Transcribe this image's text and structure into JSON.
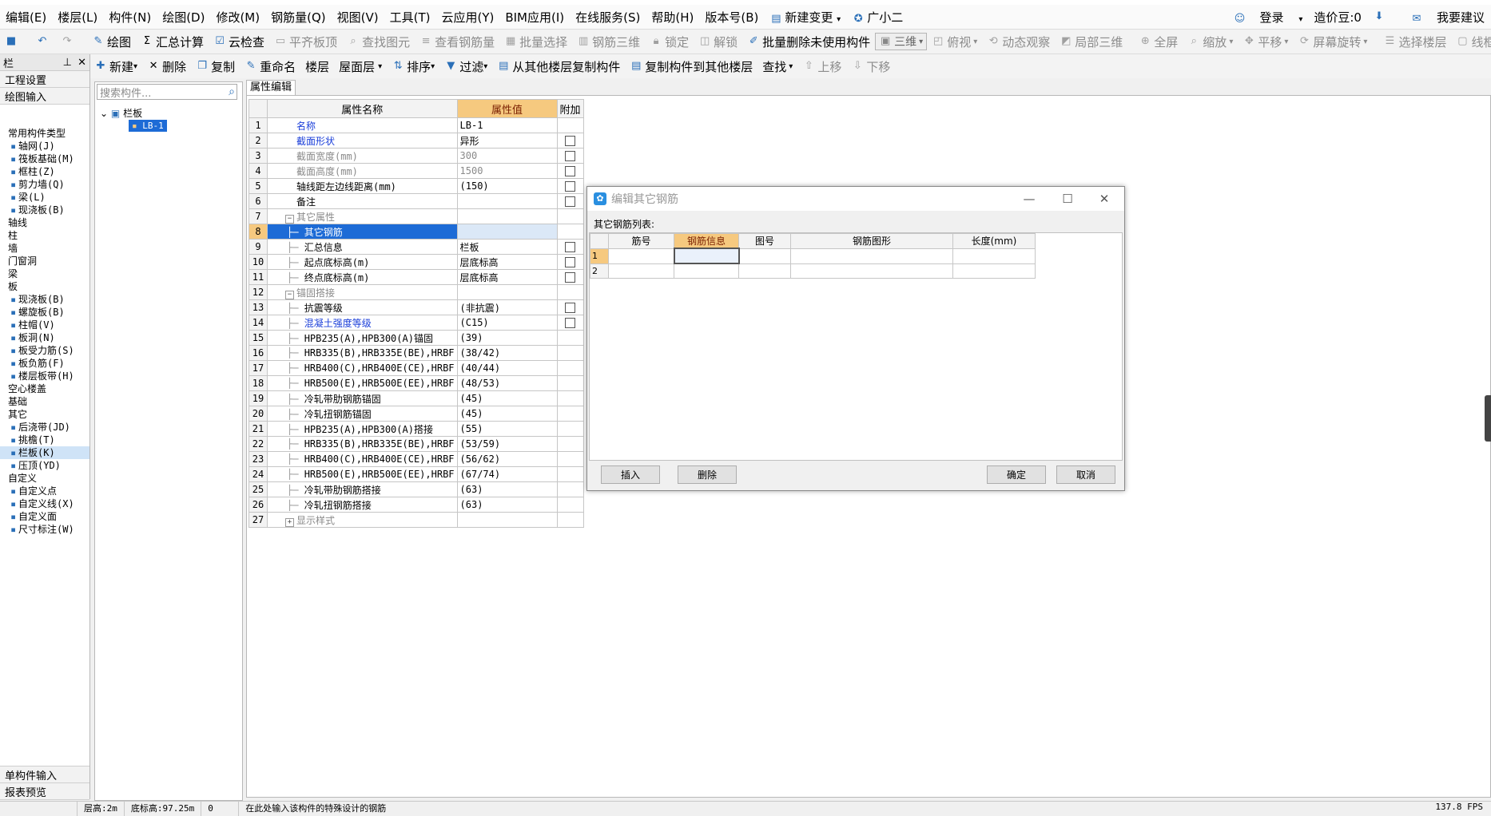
{
  "menu": {
    "items": [
      "编辑(E)",
      "楼层(L)",
      "构件(N)",
      "绘图(D)",
      "修改(M)",
      "钢筋量(Q)",
      "视图(V)",
      "工具(T)",
      "云应用(Y)",
      "BIM应用(I)",
      "在线服务(S)",
      "帮助(H)",
      "版本号(B)",
      "新建变更",
      "广小二"
    ],
    "login": "登录",
    "beans": "造价豆:0",
    "suggest": "我要建议"
  },
  "toolbar1": {
    "draw": "绘图",
    "sum": "汇总计算",
    "cloud_check": "云检查",
    "flat_top": "平齐板顶",
    "find_elem": "查找图元",
    "view_rebar": "查看钢筋量",
    "batch_select": "批量选择",
    "rebar_3d": "钢筋三维",
    "lock": "锁定",
    "unlock": "解锁",
    "batch_delete": "批量删除未使用构件",
    "view3d": "三维",
    "top_view": "俯视",
    "dynamic": "动态观察",
    "local3d": "局部三维",
    "fullscreen": "全屏",
    "zoom": "缩放",
    "pan": "平移",
    "rotate": "屏幕旋转",
    "select_floor": "选择楼层",
    "wireframe": "线框"
  },
  "toolbar2": {
    "new": "新建",
    "delete": "删除",
    "copy": "复制",
    "rename": "重命名",
    "floor": "楼层",
    "floor_value": "屋面层",
    "sort": "排序",
    "filter": "过滤",
    "copy_from": "从其他楼层复制构件",
    "copy_to": "复制构件到其他楼层",
    "find": "查找",
    "up": "上移",
    "down": "下移"
  },
  "leftnav": {
    "header": "栏",
    "project": "工程设置",
    "draw_input": "绘图输入",
    "bottom1": "单构件输入",
    "bottom2": "报表预览",
    "items": [
      {
        "text": "常用构件类型",
        "sub": false
      },
      {
        "text": "轴网(J)",
        "sub": true
      },
      {
        "text": "筏板基础(M)",
        "sub": true
      },
      {
        "text": "框柱(Z)",
        "sub": true
      },
      {
        "text": "剪力墙(Q)",
        "sub": true
      },
      {
        "text": "梁(L)",
        "sub": true
      },
      {
        "text": "现浇板(B)",
        "sub": true
      },
      {
        "text": "轴线",
        "sub": false
      },
      {
        "text": "柱",
        "sub": false
      },
      {
        "text": "墙",
        "sub": false
      },
      {
        "text": "门窗洞",
        "sub": false
      },
      {
        "text": "梁",
        "sub": false
      },
      {
        "text": "板",
        "sub": false
      },
      {
        "text": "现浇板(B)",
        "sub": true
      },
      {
        "text": "螺旋板(B)",
        "sub": true
      },
      {
        "text": "柱帽(V)",
        "sub": true
      },
      {
        "text": "板洞(N)",
        "sub": true
      },
      {
        "text": "板受力筋(S)",
        "sub": true
      },
      {
        "text": "板负筋(F)",
        "sub": true
      },
      {
        "text": "楼层板带(H)",
        "sub": true
      },
      {
        "text": "空心楼盖",
        "sub": false
      },
      {
        "text": "基础",
        "sub": false
      },
      {
        "text": "其它",
        "sub": false
      },
      {
        "text": "后浇带(JD)",
        "sub": true
      },
      {
        "text": "挑檐(T)",
        "sub": true
      },
      {
        "text": "栏板(K)",
        "sub": true,
        "selected": true
      },
      {
        "text": "压顶(YD)",
        "sub": true
      },
      {
        "text": "自定义",
        "sub": false
      },
      {
        "text": "自定义点",
        "sub": true
      },
      {
        "text": "自定义线(X)",
        "sub": true
      },
      {
        "text": "自定义面",
        "sub": true
      },
      {
        "text": "尺寸标注(W)",
        "sub": true
      }
    ]
  },
  "tree": {
    "search_placeholder": "搜索构件...",
    "root": "栏板",
    "child": "LB-1"
  },
  "props": {
    "tab": "属性编辑",
    "headers": [
      "属性名称",
      "属性值",
      "附加"
    ],
    "rows": [
      {
        "n": "1",
        "name": "名称",
        "value": "LB-1",
        "style": "blue",
        "cb": false
      },
      {
        "n": "2",
        "name": "截面形状",
        "value": "异形",
        "style": "blue",
        "cb": true
      },
      {
        "n": "3",
        "name": "截面宽度(mm)",
        "value": "300",
        "style": "gray",
        "cb": true
      },
      {
        "n": "4",
        "name": "截面高度(mm)",
        "value": "1500",
        "style": "gray",
        "cb": true
      },
      {
        "n": "5",
        "name": "轴线距左边线距离(mm)",
        "value": "(150)",
        "style": "",
        "cb": true
      },
      {
        "n": "6",
        "name": "备注",
        "value": "",
        "style": "",
        "cb": true
      },
      {
        "n": "7",
        "name": "其它属性",
        "value": "",
        "style": "group",
        "cb": false
      },
      {
        "n": "8",
        "name": "其它钢筋",
        "value": "",
        "style": "sel",
        "cb": false
      },
      {
        "n": "9",
        "name": "汇总信息",
        "value": "栏板",
        "style": "ind",
        "cb": true
      },
      {
        "n": "10",
        "name": "起点底标高(m)",
        "value": "层底标高",
        "style": "ind",
        "cb": true
      },
      {
        "n": "11",
        "name": "终点底标高(m)",
        "value": "层底标高",
        "style": "ind",
        "cb": true
      },
      {
        "n": "12",
        "name": "锚固搭接",
        "value": "",
        "style": "group",
        "cb": false
      },
      {
        "n": "13",
        "name": "抗震等级",
        "value": "(非抗震)",
        "style": "ind",
        "cb": true
      },
      {
        "n": "14",
        "name": "混凝土强度等级",
        "value": "(C15)",
        "style": "indblue",
        "cb": true
      },
      {
        "n": "15",
        "name": "HPB235(A),HPB300(A)锚固",
        "value": "(39)",
        "style": "ind",
        "cb": false
      },
      {
        "n": "16",
        "name": "HRB335(B),HRB335E(BE),HRBF",
        "value": "(38/42)",
        "style": "ind",
        "cb": false
      },
      {
        "n": "17",
        "name": "HRB400(C),HRB400E(CE),HRBF",
        "value": "(40/44)",
        "style": "ind",
        "cb": false
      },
      {
        "n": "18",
        "name": "HRB500(E),HRB500E(EE),HRBF",
        "value": "(48/53)",
        "style": "ind",
        "cb": false
      },
      {
        "n": "19",
        "name": "冷轧带肋钢筋锚固",
        "value": "(45)",
        "style": "ind",
        "cb": false
      },
      {
        "n": "20",
        "name": "冷轧扭钢筋锚固",
        "value": "(45)",
        "style": "ind",
        "cb": false
      },
      {
        "n": "21",
        "name": "HPB235(A),HPB300(A)搭接",
        "value": "(55)",
        "style": "ind",
        "cb": false
      },
      {
        "n": "22",
        "name": "HRB335(B),HRB335E(BE),HRBF",
        "value": "(53/59)",
        "style": "ind",
        "cb": false
      },
      {
        "n": "23",
        "name": "HRB400(C),HRB400E(CE),HRBF",
        "value": "(56/62)",
        "style": "ind",
        "cb": false
      },
      {
        "n": "24",
        "name": "HRB500(E),HRB500E(EE),HRBF",
        "value": "(67/74)",
        "style": "ind",
        "cb": false
      },
      {
        "n": "25",
        "name": "冷轧带肋钢筋搭接",
        "value": "(63)",
        "style": "ind",
        "cb": false
      },
      {
        "n": "26",
        "name": "冷轧扭钢筋搭接",
        "value": "(63)",
        "style": "ind",
        "cb": false
      },
      {
        "n": "27",
        "name": "显示样式",
        "value": "",
        "style": "groupplus",
        "cb": false
      }
    ]
  },
  "dialog": {
    "title": "编辑其它钢筋",
    "list_label": "其它钢筋列表:",
    "headers": [
      "筋号",
      "钢筋信息",
      "图号",
      "钢筋图形",
      "长度(mm)"
    ],
    "rows": [
      "1",
      "2"
    ],
    "insert": "插入",
    "delete": "删除",
    "ok": "确定",
    "cancel": "取消"
  },
  "status": {
    "floor_height": "层高:2m",
    "bottom_elev": "底标高:97.25m",
    "zero": "0",
    "hint": "在此处输入该构件的特殊设计的钢筋",
    "fps": "137.8 FPS"
  }
}
